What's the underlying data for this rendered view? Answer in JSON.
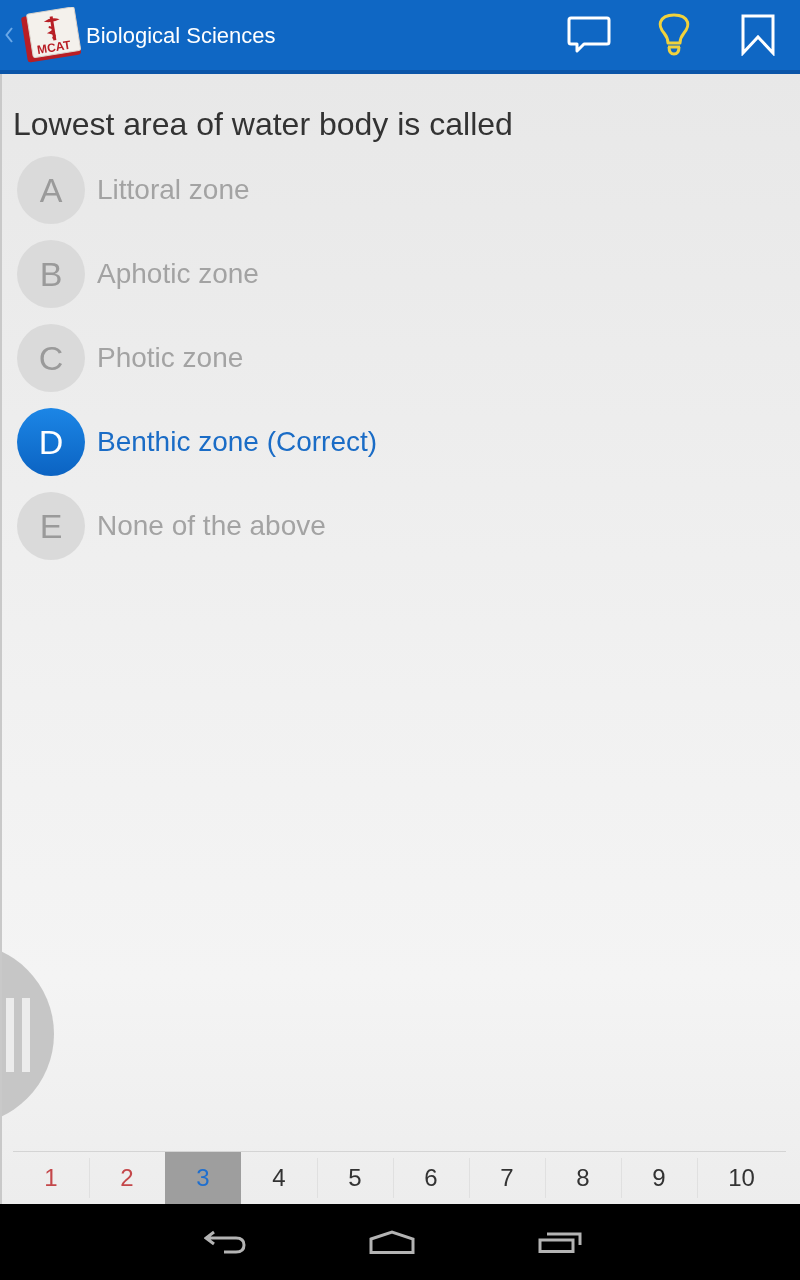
{
  "header": {
    "title": "Biological Sciences",
    "logo_text": "MCAT"
  },
  "question": {
    "text": "Lowest area of water body is called",
    "options": [
      {
        "letter": "A",
        "text": "Littoral zone",
        "selected": false
      },
      {
        "letter": "B",
        "text": "Aphotic zone",
        "selected": false
      },
      {
        "letter": "C",
        "text": "Photic zone",
        "selected": false
      },
      {
        "letter": "D",
        "text": "Benthic zone (Correct)",
        "selected": true
      },
      {
        "letter": "E",
        "text": "None of the above",
        "selected": false
      }
    ]
  },
  "pages": [
    {
      "label": "1",
      "selected": false,
      "color": "#c4474a"
    },
    {
      "label": "2",
      "selected": false,
      "color": "#c4474a"
    },
    {
      "label": "3",
      "selected": true
    },
    {
      "label": "4",
      "selected": false,
      "color": "#333333"
    },
    {
      "label": "5",
      "selected": false,
      "color": "#333333"
    },
    {
      "label": "6",
      "selected": false,
      "color": "#333333"
    },
    {
      "label": "7",
      "selected": false,
      "color": "#333333"
    },
    {
      "label": "8",
      "selected": false,
      "color": "#333333"
    },
    {
      "label": "9",
      "selected": false,
      "color": "#333333"
    },
    {
      "label": "10",
      "selected": false,
      "color": "#333333"
    }
  ]
}
